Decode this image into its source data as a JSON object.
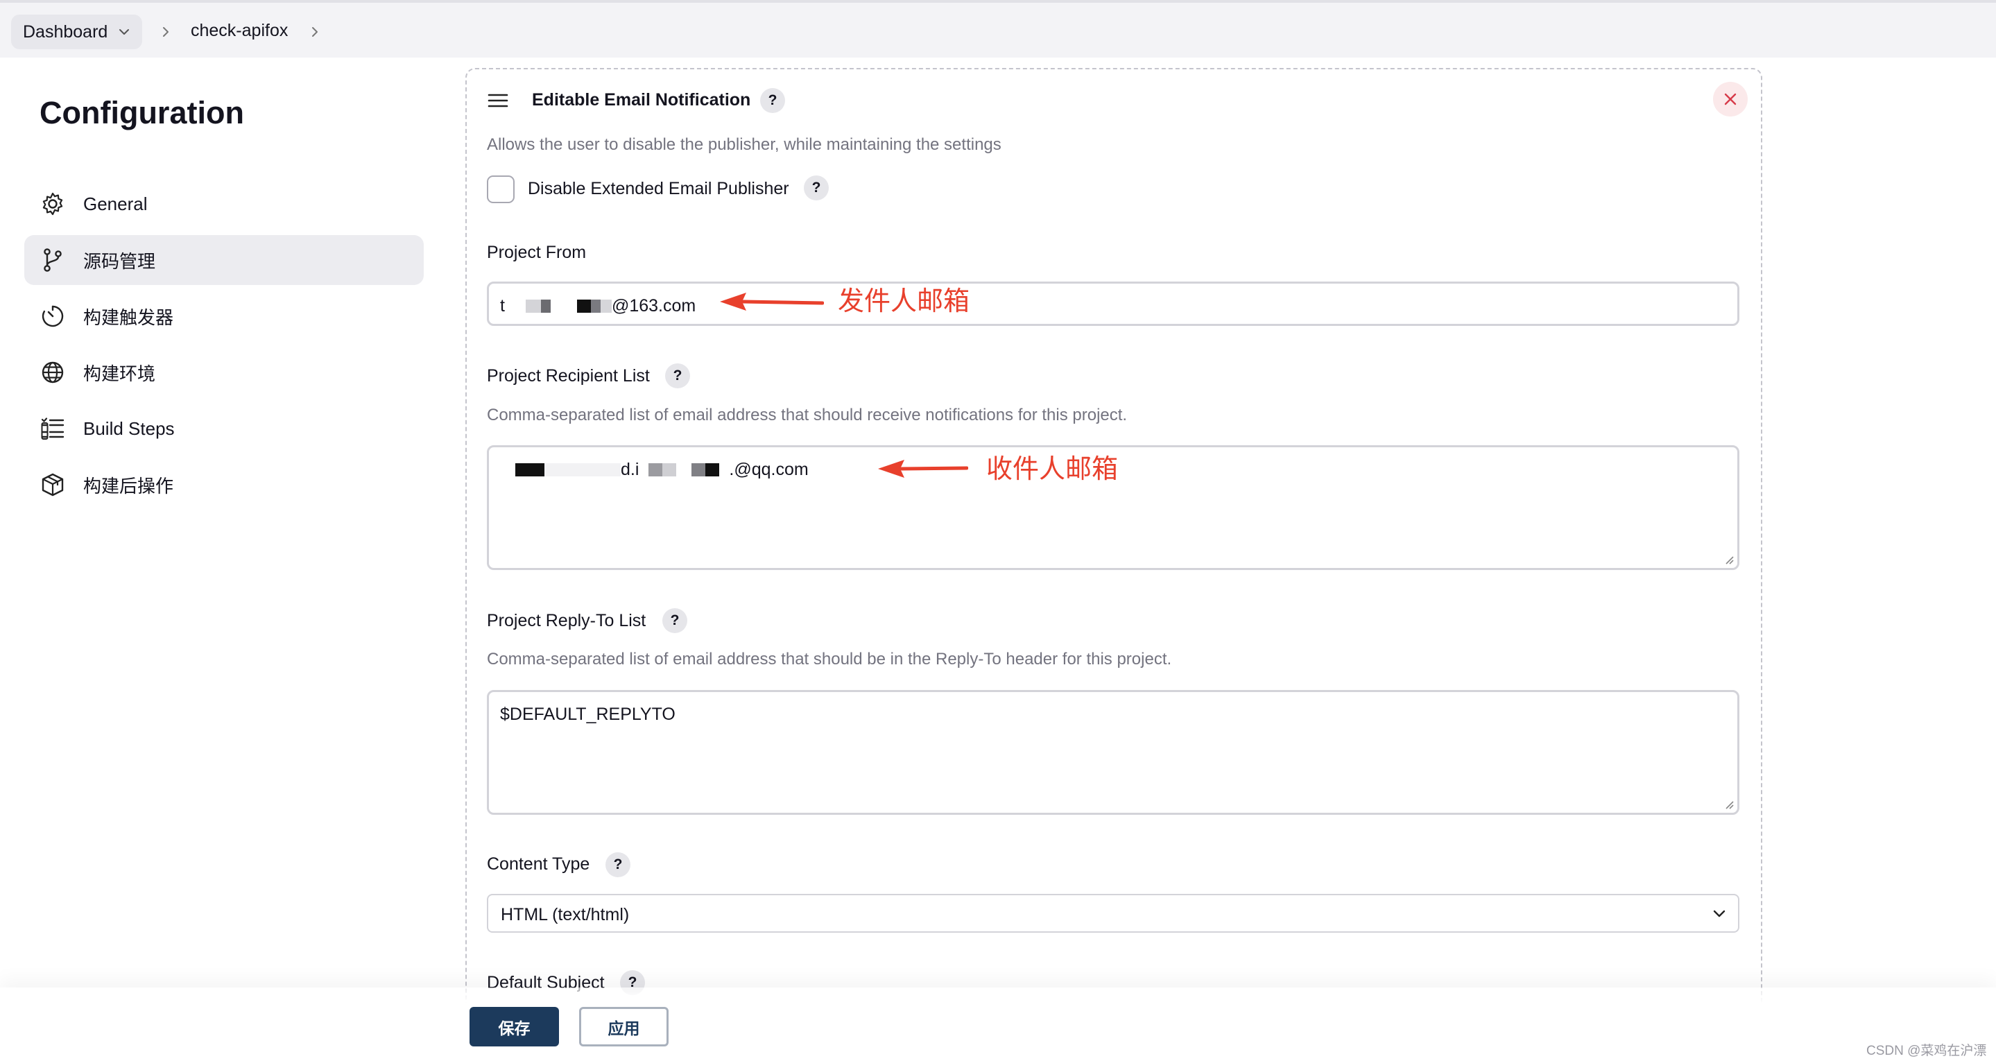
{
  "breadcrumb": {
    "dashboard": "Dashboard",
    "job": "check-apifox"
  },
  "sidebar": {
    "title": "Configuration",
    "items": [
      {
        "label": "General",
        "icon": "gear-icon"
      },
      {
        "label": "源码管理",
        "icon": "git-branch-icon"
      },
      {
        "label": "构建触发器",
        "icon": "timer-icon"
      },
      {
        "label": "构建环境",
        "icon": "globe-icon"
      },
      {
        "label": "Build Steps",
        "icon": "list-steps-icon"
      },
      {
        "label": "构建后操作",
        "icon": "package-icon"
      }
    ],
    "active_index": 1
  },
  "panel": {
    "title": "Editable Email Notification",
    "help_glyph": "?",
    "disable_desc": "Allows the user to disable the publisher, while maintaining the settings",
    "disable_label": "Disable Extended Email Publisher",
    "disable_checked": false,
    "project_from": {
      "label": "Project From",
      "value_prefix": "t",
      "value_suffix": "@163.com"
    },
    "recipient": {
      "label": "Project Recipient List",
      "desc": "Comma-separated list of email address that should receive notifications for this project.",
      "value_mid": "d.i",
      "value_suffix": ".@qq.com"
    },
    "reply_to": {
      "label": "Project Reply-To List",
      "desc": "Comma-separated list of email address that should be in the Reply-To header for this project.",
      "value": "$DEFAULT_REPLYTO"
    },
    "content_type": {
      "label": "Content Type",
      "selected": "HTML (text/html)"
    },
    "default_subject": {
      "label": "Default Subject"
    }
  },
  "annotations": {
    "sender": "发件人邮箱",
    "recipient": "收件人邮箱",
    "color": "#e8402c"
  },
  "actions": {
    "save": "保存",
    "apply": "应用"
  },
  "watermark": "CSDN @菜鸡在沪漂",
  "colors": {
    "primary": "#1c3a5c",
    "sidebar_active": "#ececf0",
    "close_bg": "#fbe9ea",
    "close_icon": "#d73a49"
  }
}
